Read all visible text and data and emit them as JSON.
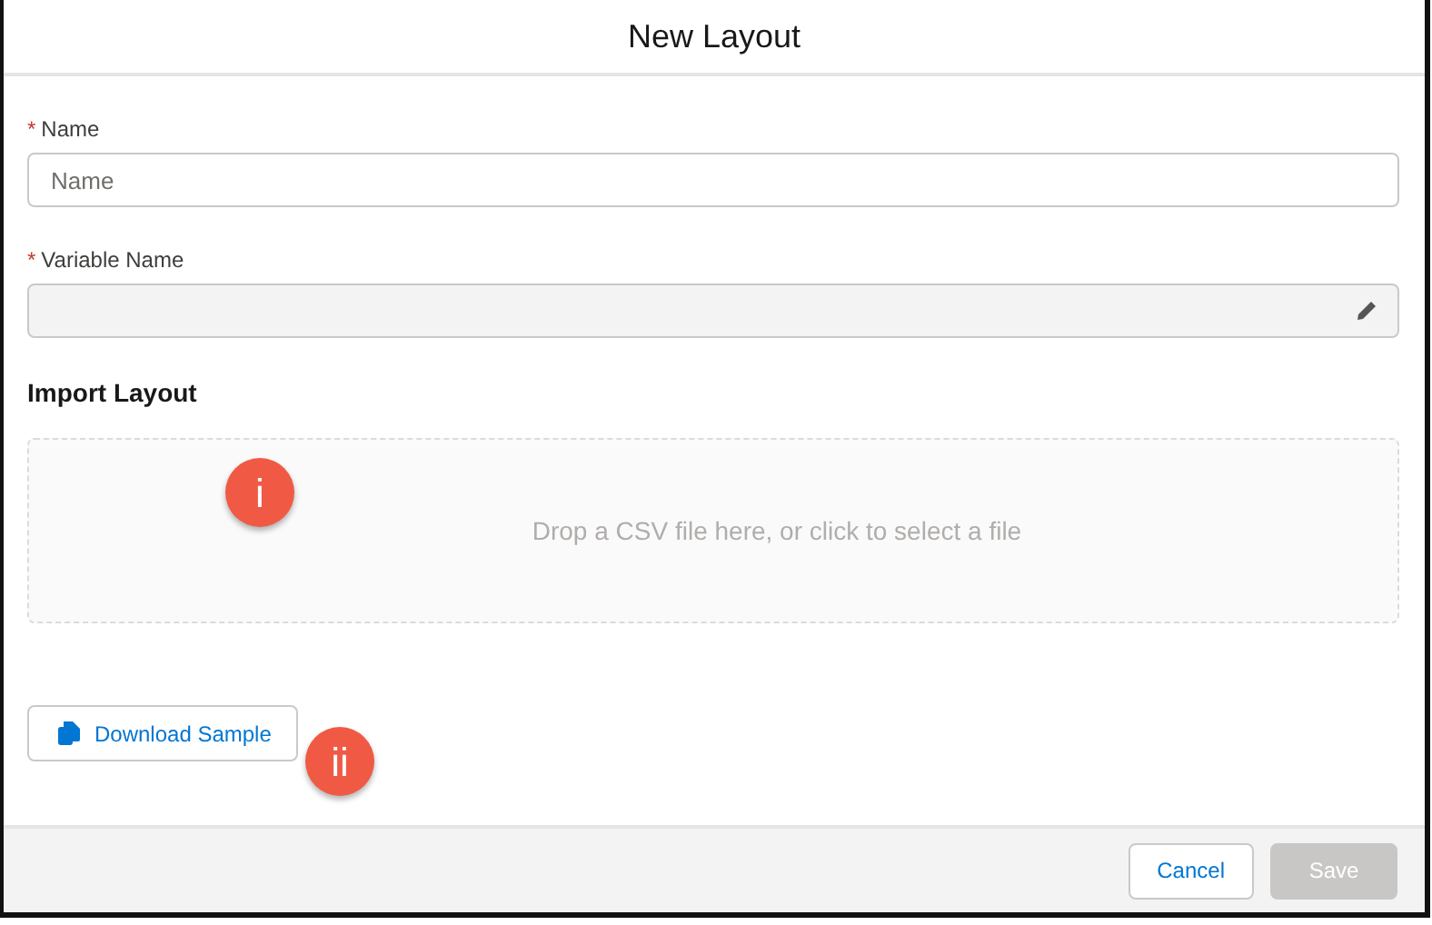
{
  "dialog": {
    "title": "New Layout"
  },
  "fields": [
    {
      "required_mark": "*",
      "label": "Name",
      "placeholder": "Name",
      "disabled": false,
      "kind": "text"
    },
    {
      "required_mark": "*",
      "label": "Variable Name",
      "disabled": true,
      "kind": "editable"
    }
  ],
  "import": {
    "heading": "Import Layout",
    "dropzone_text": "Drop a CSV file here, or click to select a file"
  },
  "download_button": {
    "label": "Download Sample"
  },
  "callouts": [
    {
      "label": "i"
    },
    {
      "label": "ii"
    }
  ],
  "footer_buttons": [
    {
      "label": "Cancel",
      "disabled": false
    },
    {
      "label": "Save",
      "disabled": true
    }
  ]
}
